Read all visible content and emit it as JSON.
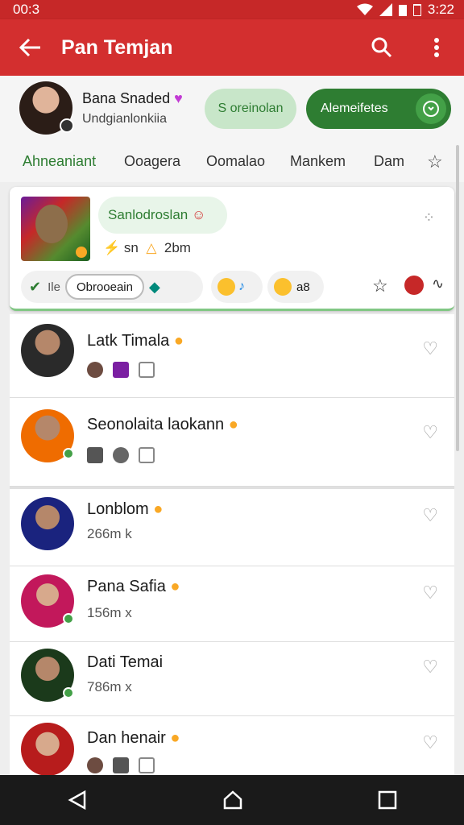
{
  "status": {
    "time": "00:3",
    "clock_right": "3:22"
  },
  "appbar": {
    "title": "Pan Temjan"
  },
  "profile": {
    "name": "Bana Snaded",
    "subtitle": "Undgianlonkiia",
    "pill_light": "S oreinolan",
    "pill_dark": "Alemeifetes"
  },
  "tabs": [
    {
      "label": "Ahneaniant"
    },
    {
      "label": "Ooagera"
    },
    {
      "label": "Oomalao"
    },
    {
      "label": "Mankem"
    },
    {
      "label": "Dam"
    }
  ],
  "card": {
    "chip": "Sanlodroslan",
    "meta_distance": "2bm",
    "meta_count": "sn",
    "chip_text": "Ile",
    "outline_chip": "Obrooeain",
    "emoji_count": "a8"
  },
  "friends": [
    {
      "name": "Latk Timala",
      "sub": ""
    },
    {
      "name": "Seonolaita laokann",
      "sub": ""
    },
    {
      "name": "Lonblom",
      "sub": "266m  k"
    },
    {
      "name": "Pana Safia",
      "sub": "156m  x"
    },
    {
      "name": "Dati Temai",
      "sub": "786m  x"
    },
    {
      "name": "Dan henair",
      "sub": ""
    }
  ],
  "colors": {
    "primary": "#d32f2f",
    "accent": "#2e7d32"
  }
}
